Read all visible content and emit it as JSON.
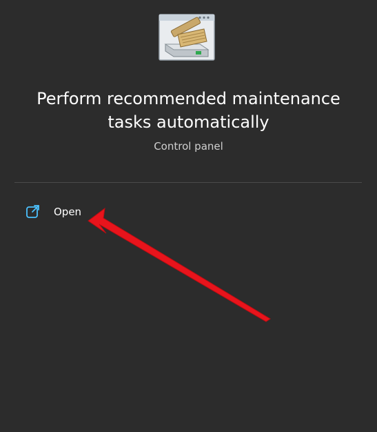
{
  "header": {
    "icon": "disk-cleanup-icon",
    "title": "Perform recommended maintenance tasks automatically",
    "subtitle": "Control panel"
  },
  "actions": [
    {
      "label": "Open",
      "icon": "open-external-icon"
    }
  ],
  "annotation": {
    "type": "arrow",
    "color": "#e8141c",
    "points_to": "Open"
  },
  "colors": {
    "background": "#2c2c2c",
    "text": "#ffffff",
    "subtext": "#d0d0d0",
    "divider": "#4a4a4a",
    "accent": "#4cc2ff"
  }
}
